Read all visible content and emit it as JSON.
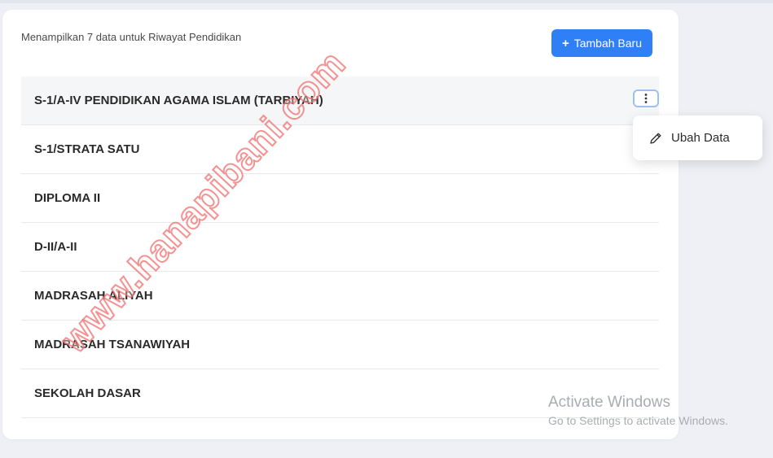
{
  "summary_text": "Menampilkan 7 data untuk Riwayat Pendidikan",
  "add_button": {
    "label": "Tambah Baru",
    "icon": "plus-icon",
    "color": "#2f80f7"
  },
  "education_items": [
    {
      "label": "S-1/A-IV PENDIDIKAN AGAMA ISLAM (TARBIYAH)"
    },
    {
      "label": "S-1/STRATA SATU"
    },
    {
      "label": "DIPLOMA II"
    },
    {
      "label": "D-II/A-II"
    },
    {
      "label": "MADRASAH ALIYAH"
    },
    {
      "label": "MADRASAH TSANAWIYAH"
    },
    {
      "label": "SEKOLAH DASAR"
    }
  ],
  "row_menu": {
    "icon": "kebab-menu-icon",
    "items": [
      {
        "label": "Ubah Data",
        "icon": "pencil-icon"
      }
    ]
  },
  "watermark_text": "www.hanapibani.com",
  "os_notice": {
    "title": "Activate Windows",
    "subtitle": "Go to Settings to activate Windows."
  }
}
